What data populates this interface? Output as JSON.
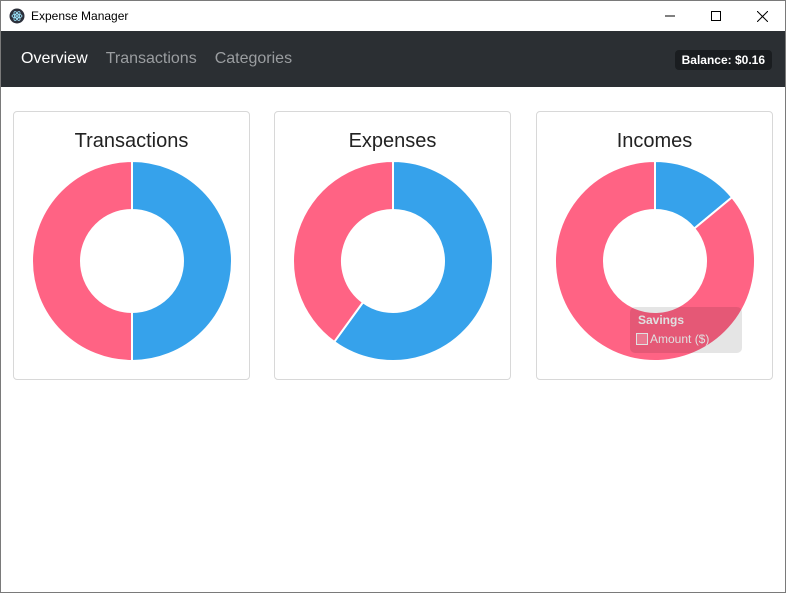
{
  "window": {
    "title": "Expense Manager",
    "icon": "electron-atom-icon"
  },
  "navbar": {
    "links": [
      {
        "label": "Overview",
        "active": true
      },
      {
        "label": "Transactions",
        "active": false
      },
      {
        "label": "Categories",
        "active": false
      }
    ],
    "balance": "Balance: $0.16"
  },
  "colors": {
    "blue": "#36a2eb",
    "pink": "#ff6384",
    "navbar_bg": "#2b2f33"
  },
  "chart_data": [
    {
      "type": "pie",
      "title": "Transactions",
      "categories": [
        "blue-segment",
        "pink-segment"
      ],
      "values": [
        50,
        50
      ],
      "colors": [
        "#36a2eb",
        "#ff6384"
      ]
    },
    {
      "type": "pie",
      "title": "Expenses",
      "categories": [
        "blue-segment",
        "pink-segment"
      ],
      "values": [
        60,
        40
      ],
      "colors": [
        "#36a2eb",
        "#ff6384"
      ]
    },
    {
      "type": "pie",
      "title": "Incomes",
      "categories": [
        "blue-segment",
        "pink-segment"
      ],
      "values": [
        14,
        86
      ],
      "colors": [
        "#36a2eb",
        "#ff6384"
      ],
      "tooltip": {
        "title": "Savings",
        "label": "Amount ($)"
      }
    }
  ]
}
